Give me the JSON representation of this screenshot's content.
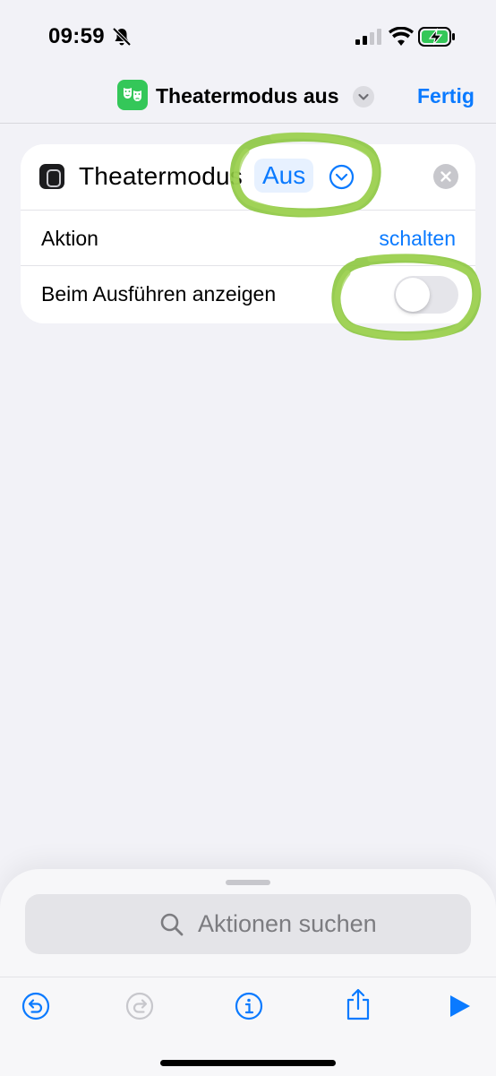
{
  "status_bar": {
    "time": "09:59",
    "icons": [
      "bell-slash-icon",
      "cellular-signal-icon",
      "wifi-icon",
      "battery-charging-icon"
    ]
  },
  "nav": {
    "app_icon": "theater-masks-icon",
    "title": "Theatermodus aus",
    "done_label": "Fertig"
  },
  "action_card": {
    "icon": "watch-icon",
    "title": "Theatermodus",
    "parameter_value": "Aus",
    "rows": [
      {
        "label": "Aktion",
        "value": "schalten"
      },
      {
        "label": "Beim Ausführen anzeigen",
        "toggle_on": false
      }
    ]
  },
  "bottom_sheet": {
    "search_placeholder": "Aktionen suchen",
    "toolbar": [
      "undo-icon",
      "redo-icon",
      "info-icon",
      "share-icon",
      "play-icon"
    ]
  },
  "colors": {
    "accent": "#0a7aff",
    "background": "#f2f2f7",
    "highlight": "#8cc63f",
    "app_icon": "#34c759"
  }
}
